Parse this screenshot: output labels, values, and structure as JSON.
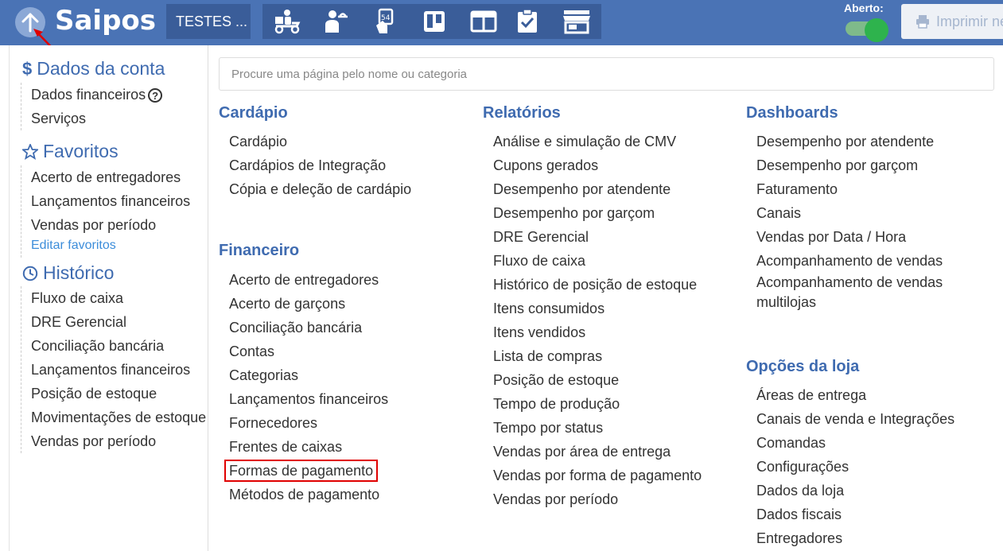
{
  "topbar": {
    "logo_text": "Saipos",
    "store_button": "TESTES ...",
    "status_label": "Aberto:",
    "print_button": "Imprimir ne",
    "tool_icons": [
      "delivery-icon",
      "waiter-icon",
      "table-tag-icon",
      "kanban-icon",
      "panel-icon",
      "checklist-icon",
      "store-icon"
    ],
    "accent": "#4a73b5"
  },
  "sidebar": {
    "account": {
      "title": "Dados da conta",
      "items": [
        "Dados financeiros",
        "Serviços"
      ]
    },
    "favorites": {
      "title": "Favoritos",
      "items": [
        "Acerto de entregadores",
        "Lançamentos financeiros",
        "Vendas por período"
      ],
      "edit_label": "Editar favoritos"
    },
    "history": {
      "title": "Histórico",
      "items": [
        "Fluxo de caixa",
        "DRE Gerencial",
        "Conciliação bancária",
        "Lançamentos financeiros",
        "Posição de estoque",
        "Movimentações de estoque",
        "Vendas por período"
      ]
    }
  },
  "search": {
    "placeholder": "Procure uma página pelo nome ou categoria"
  },
  "menu": {
    "cardapio": {
      "title": "Cardápio",
      "items": [
        "Cardápio",
        "Cardápios de Integração",
        "Cópia e deleção de cardápio"
      ]
    },
    "financeiro": {
      "title": "Financeiro",
      "items": [
        "Acerto de entregadores",
        "Acerto de garçons",
        "Conciliação bancária",
        "Contas",
        "Categorias",
        "Lançamentos financeiros",
        "Fornecedores",
        "Frentes de caixas",
        "Formas de pagamento",
        "Métodos de pagamento"
      ]
    },
    "relatorios": {
      "title": "Relatórios",
      "items": [
        "Análise e simulação de CMV",
        "Cupons gerados",
        "Desempenho por atendente",
        "Desempenho por garçom",
        "DRE Gerencial",
        "Fluxo de caixa",
        "Histórico de posição de estoque",
        "Itens consumidos",
        "Itens vendidos",
        "Lista de compras",
        "Posição de estoque",
        "Tempo de produção",
        "Tempo por status",
        "Vendas por área de entrega",
        "Vendas por forma de pagamento",
        "Vendas por período"
      ]
    },
    "dashboards": {
      "title": "Dashboards",
      "items": [
        "Desempenho por atendente",
        "Desempenho por garçom",
        "Faturamento",
        "Canais",
        "Vendas por Data / Hora",
        "Acompanhamento de vendas",
        "Acompanhamento de vendas multilojas"
      ]
    },
    "opcoes": {
      "title": "Opções da loja",
      "items": [
        "Áreas de entrega",
        "Canais de venda e Integrações",
        "Comandas",
        "Configurações",
        "Dados da loja",
        "Dados fiscais",
        "Entregadores"
      ]
    }
  }
}
